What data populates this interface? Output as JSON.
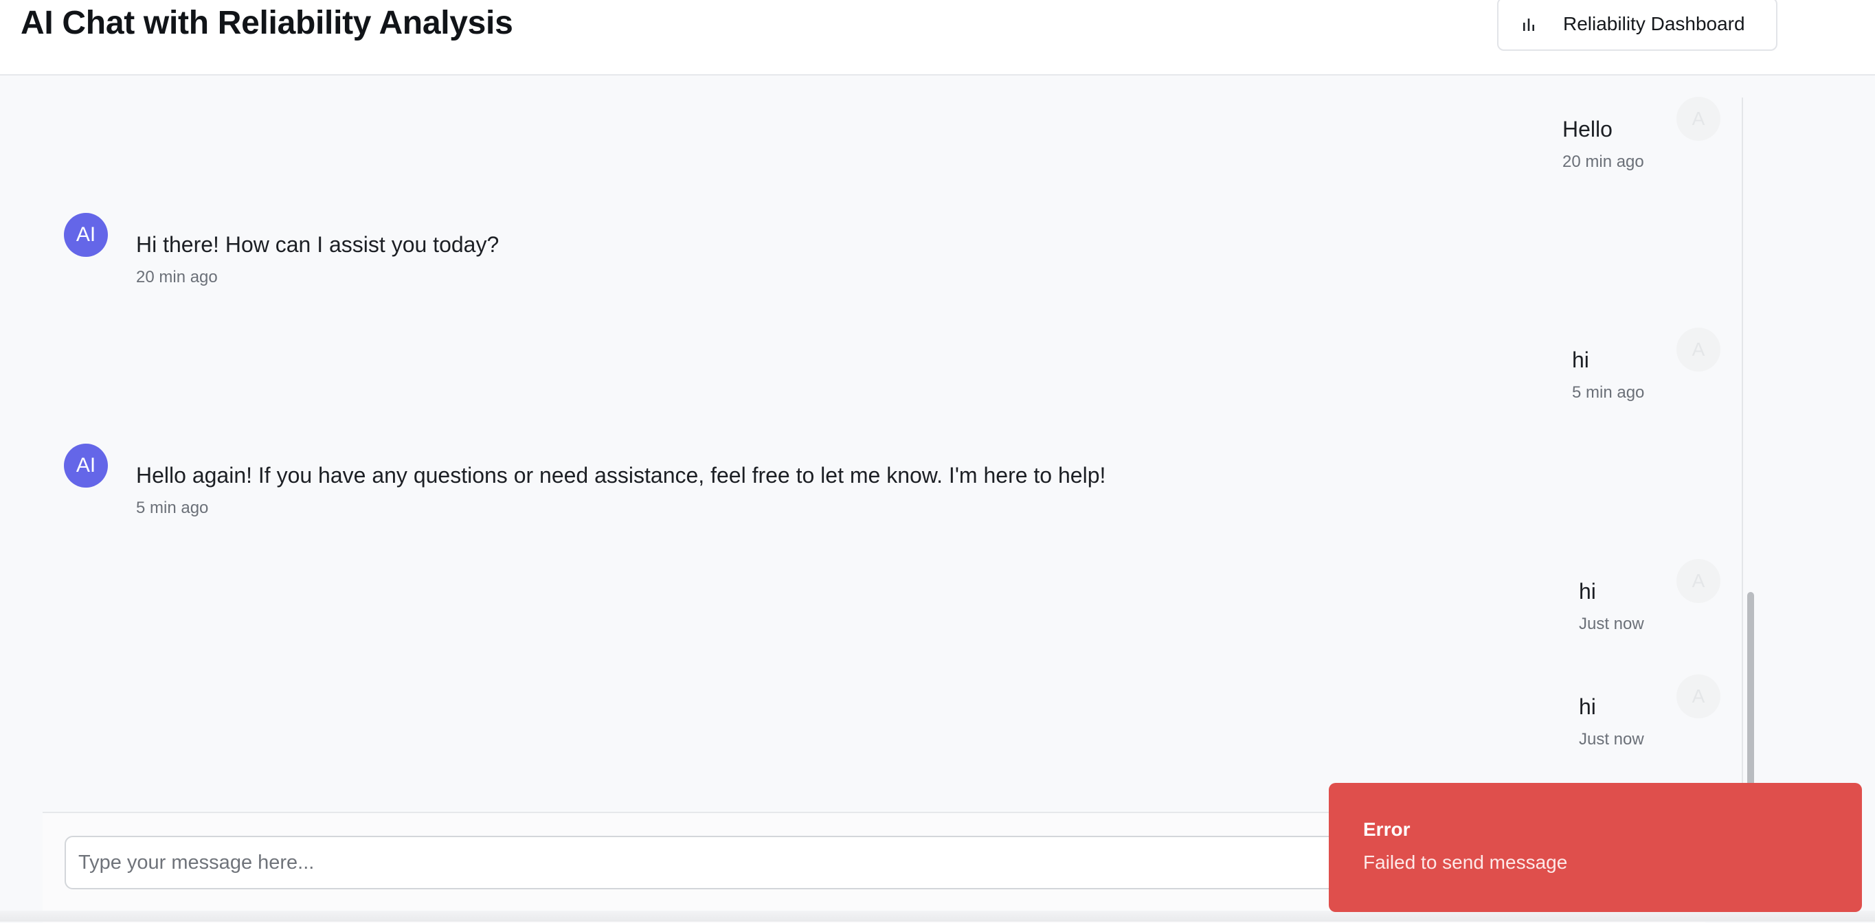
{
  "header": {
    "title": "AI Chat with Reliability Analysis",
    "dashboard_button": {
      "label": "Reliability Dashboard",
      "icon": "bar-chart-icon"
    }
  },
  "messages": [
    {
      "role": "user",
      "text": "Hello",
      "time": "20 min ago",
      "avatar": "A"
    },
    {
      "role": "ai",
      "text": "Hi there! How can I assist you today?",
      "time": "20 min ago",
      "avatar": "AI"
    },
    {
      "role": "user",
      "text": "hi",
      "time": "5 min ago",
      "avatar": "A"
    },
    {
      "role": "ai",
      "text": "Hello again! If you have any questions or need assistance, feel free to let me know. I'm here to help!",
      "time": "5 min ago",
      "avatar": "AI"
    },
    {
      "role": "user",
      "text": "hi",
      "time": "Just now",
      "avatar": "A"
    },
    {
      "role": "user",
      "text": "hi",
      "time": "Just now",
      "avatar": "A"
    }
  ],
  "composer": {
    "placeholder": "Type your message here...",
    "value": ""
  },
  "toast": {
    "title": "Error",
    "description": "Failed to send message"
  },
  "colors": {
    "ai_avatar": "#6466e8",
    "toast_error": "#df4f4c",
    "background": "#f8f9fb"
  }
}
